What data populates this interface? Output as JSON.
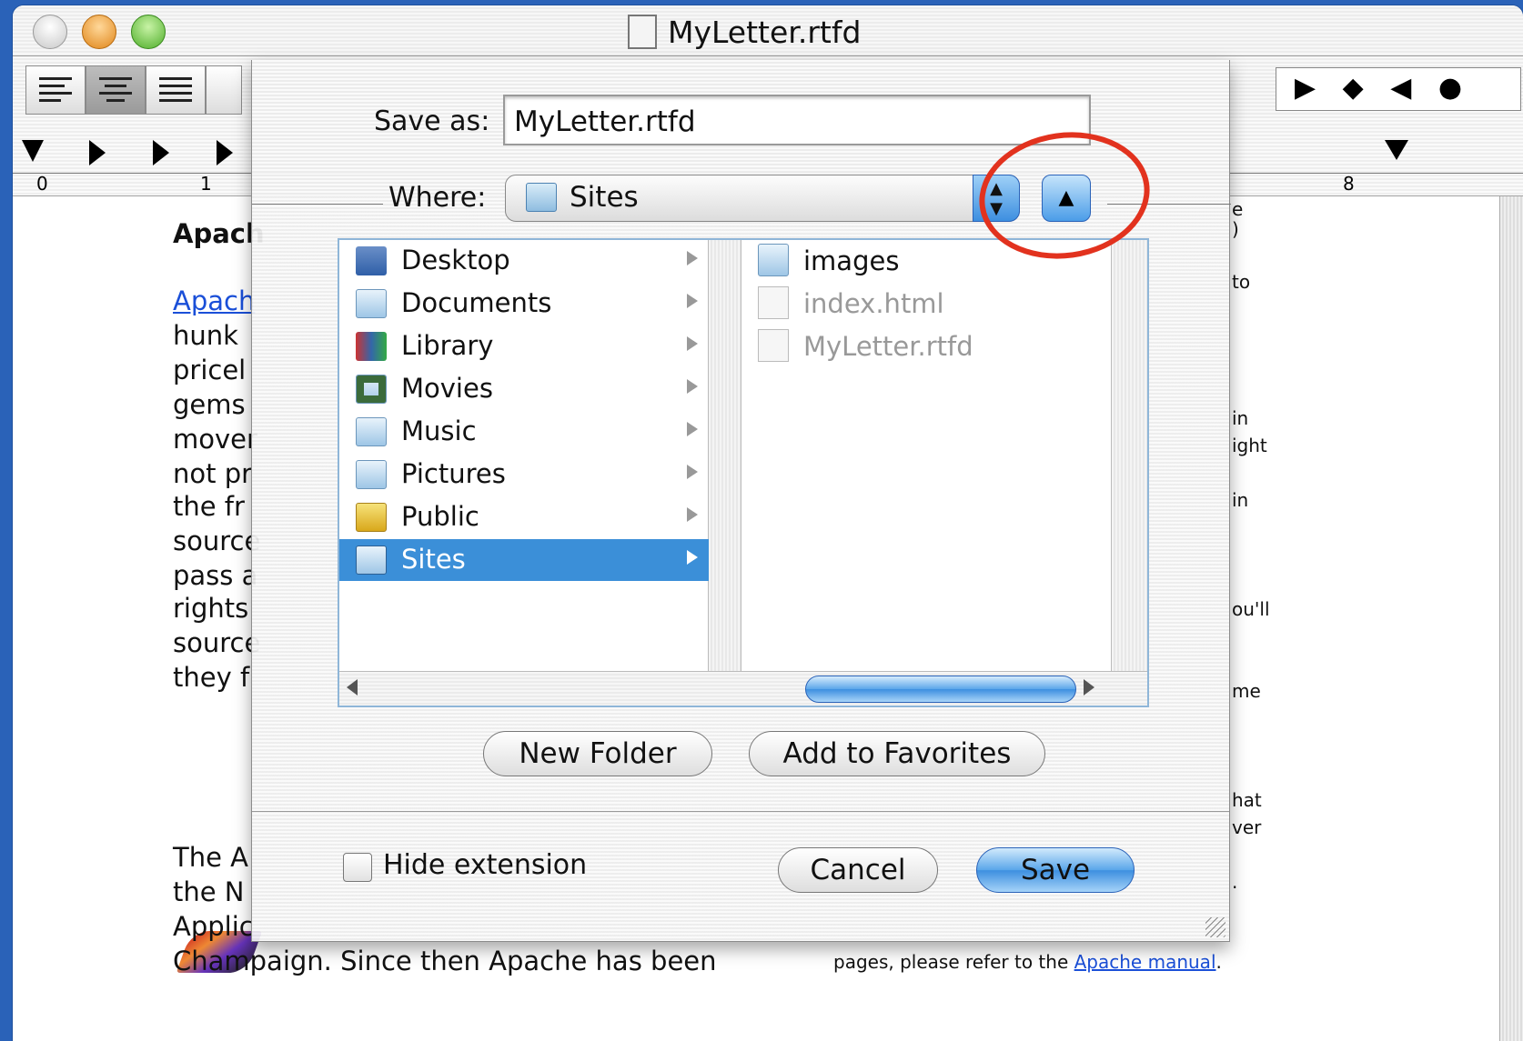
{
  "window": {
    "title": "MyLetter.rtfd"
  },
  "ruler": {
    "numbers": [
      "0",
      "1",
      "8"
    ],
    "tab_markers": "▶ ◆ ◀ ●"
  },
  "document": {
    "left_lines": [
      "Apach",
      "Apach",
      "hunk",
      "pricel",
      "gems",
      "mover",
      "not pr",
      "the fr",
      "source",
      "pass a",
      "rights",
      "source",
      "they f",
      "The A",
      "the N",
      "Applic",
      "Champaign. Since then Apache has been"
    ],
    "right_lines": [
      "e",
      ")",
      "to",
      "in",
      "ight",
      "in",
      "ou'll",
      "me",
      "hat",
      "ver",
      "."
    ],
    "footer_text": "pages, please refer to the",
    "footer_link": "Apache manual",
    "footer_end": "."
  },
  "dialog": {
    "save_as_label": "Save as:",
    "save_as_value": "MyLetter.rtfd",
    "where_label": "Where:",
    "where_value": "Sites",
    "up_button_glyph": "▲",
    "column1": [
      "Desktop",
      "Documents",
      "Library",
      "Movies",
      "Music",
      "Pictures",
      "Public",
      "Sites"
    ],
    "column1_selected": "Sites",
    "column2": [
      {
        "name": "images",
        "enabled": true
      },
      {
        "name": "index.html",
        "enabled": false
      },
      {
        "name": "MyLetter.rtfd",
        "enabled": false
      }
    ],
    "new_folder": "New Folder",
    "add_favorites": "Add to Favorites",
    "hide_extension": "Hide extension",
    "cancel": "Cancel",
    "save": "Save"
  },
  "colors": {
    "selection": "#3b8fd8",
    "highlight_circle": "#e2321e",
    "link": "#1a4fd8"
  }
}
